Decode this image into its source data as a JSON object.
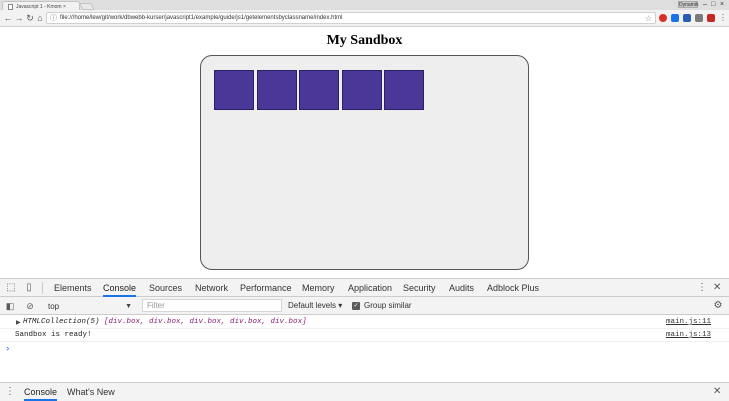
{
  "browser": {
    "tab_title": "Javascript 1 - Kmom ×",
    "tab_close": "×",
    "profile_label": "Dynamik",
    "window_controls": [
      "–",
      "□",
      "×"
    ],
    "url": "file:///home/lew/git/work/dbwebb-kurser/javascript1/example/guide/js1/getelementsbyclassname/index.html",
    "nav": {
      "back": "←",
      "forward": "→",
      "reload": "↻",
      "home": "⌂"
    },
    "menu": "⋮",
    "extensions": [
      {
        "name": "adblock",
        "color": "#d93025"
      },
      {
        "name": "pocket",
        "color": "#1a73e8"
      },
      {
        "name": "ext-blue",
        "color": "#2a5db0"
      },
      {
        "name": "ext-grey",
        "color": "#7a7a7a"
      },
      {
        "name": "ext-red",
        "color": "#c62828"
      },
      {
        "name": "ext-shield",
        "color": "#b71c1c"
      }
    ]
  },
  "page": {
    "title": "My Sandbox",
    "box_color": "#4b3797",
    "boxes": [
      "",
      "",
      "",
      "",
      ""
    ]
  },
  "devtools": {
    "tabs": [
      "Elements",
      "Console",
      "Sources",
      "Network",
      "Performance",
      "Memory",
      "Application",
      "Security",
      "Audits",
      "Adblock Plus"
    ],
    "active_tab": "Console",
    "context": "top",
    "filter_placeholder": "Filter",
    "levels": "Default levels ▾",
    "group_similar": "Group similar",
    "group_similar_checked": true,
    "console": [
      {
        "collection": "HTMLCollection(5)",
        "items": "[div.box, div.box, div.box, div.box, div.box]",
        "source": "main.js:11"
      },
      {
        "text": "Sandbox is ready!",
        "source": "main.js:13"
      }
    ],
    "prompt": "›",
    "drawer_tabs": [
      "Console",
      "What's New"
    ],
    "drawer_active": "Console"
  }
}
